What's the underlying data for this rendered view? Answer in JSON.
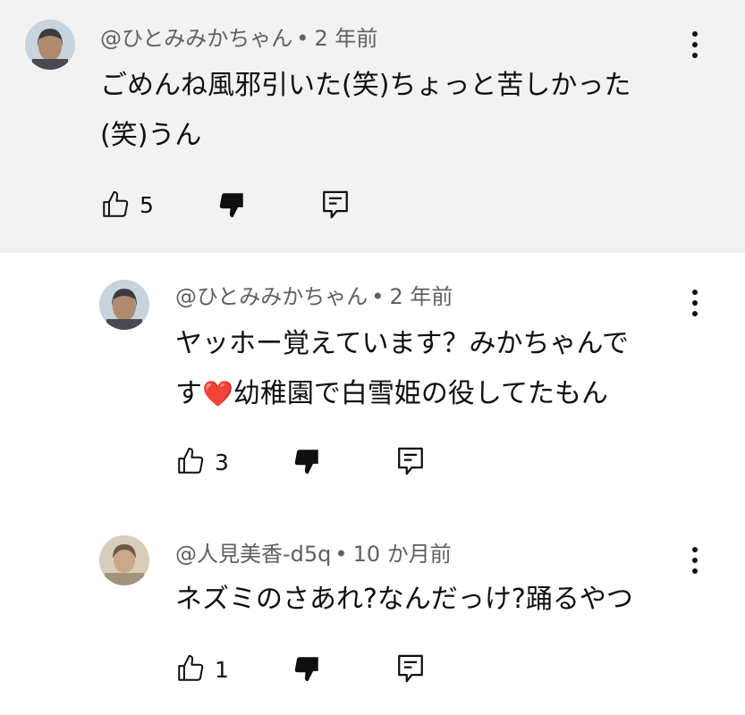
{
  "comments": [
    {
      "author": "@ひとみみかちゃん",
      "time": "2 年前",
      "lines": [
        "ごめんね風邪引いた(笑)ちょっと苦しかった",
        "(笑)うん"
      ],
      "likes": "5",
      "highlighted": true
    },
    {
      "author": "@ひとみみかちゃん",
      "time": "2 年前",
      "line1": "ヤッホー覚えています？みかちゃんで",
      "line2_prefix": "す",
      "heart": "❤️",
      "line2_suffix": "幼稚園で白雪姫の役してたもん",
      "likes": "3"
    },
    {
      "author": "@人見美香-d5q",
      "time": "10 か月前",
      "lines": [
        "ネズミのさあれ?なんだっけ?踊るやつ"
      ],
      "likes": "1"
    }
  ],
  "separator": "•",
  "icons": {
    "like": "thumbs-up-icon",
    "dislike": "thumbs-down-icon",
    "reply": "reply-icon",
    "menu": "more-vertical-icon"
  },
  "colors": {
    "highlight_bg": "#f2f2f2",
    "meta_text": "#606060",
    "text": "#0f0f0f"
  }
}
